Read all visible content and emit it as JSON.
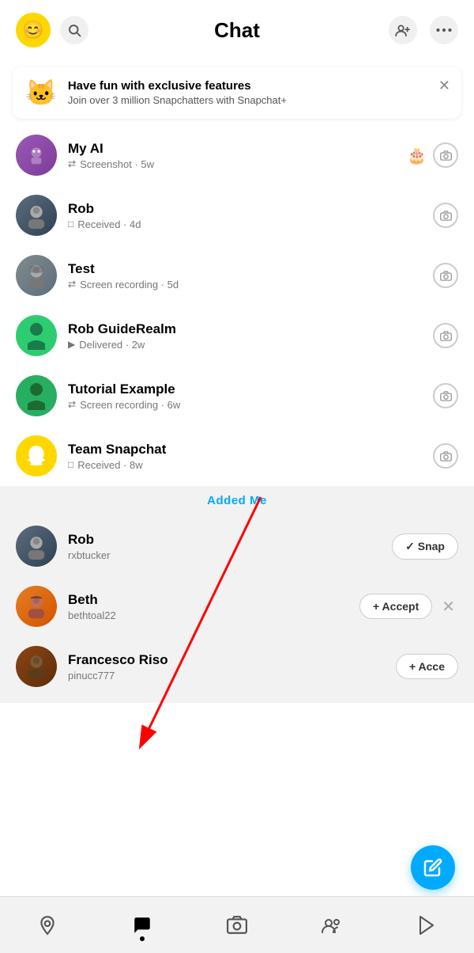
{
  "header": {
    "title": "Chat",
    "avatar_emoji": "😊",
    "add_friend_label": "+👤",
    "more_label": "•••"
  },
  "promo": {
    "emoji": "🐱",
    "title": "Have fun with exclusive features",
    "subtitle": "Join over 3 million Snapchatters with Snapchat+"
  },
  "chats": [
    {
      "name": "My AI",
      "sub_icon": "↔",
      "sub_text": "Screenshot · 5w",
      "avatar_emoji": "🤖",
      "extra_emoji": "🎂",
      "avatar_class": "avatar-myai"
    },
    {
      "name": "Rob",
      "sub_icon": "□",
      "sub_text": "Received · 4d",
      "avatar_class": "avatar-rob",
      "avatar_emoji": "🧑"
    },
    {
      "name": "Test",
      "sub_icon": "↔",
      "sub_text": "Screen recording · 5d",
      "avatar_class": "avatar-test",
      "avatar_emoji": "🧑"
    },
    {
      "name": "Rob GuideRealm",
      "sub_icon": "▶",
      "sub_text": "Delivered · 2w",
      "avatar_class": "avatar-robguide",
      "avatar_emoji": "🧑"
    },
    {
      "name": "Tutorial Example",
      "sub_icon": "↔",
      "sub_text": "Screen recording · 6w",
      "avatar_class": "avatar-tutorial",
      "avatar_emoji": "🧑"
    },
    {
      "name": "Team Snapchat",
      "sub_icon": "□",
      "sub_text": "Received · 8w",
      "avatar_class": "avatar-snapchat",
      "avatar_emoji": "👻"
    }
  ],
  "added_me": {
    "section_title": "Added Me",
    "items": [
      {
        "name": "Rob",
        "username": "rxbtucker",
        "avatar_class": "avatar-rob2",
        "avatar_emoji": "🧑",
        "action": "snap",
        "action_label": "✓ Snap"
      },
      {
        "name": "Beth",
        "username": "bethtoal22",
        "avatar_class": "avatar-beth",
        "avatar_emoji": "👩",
        "action": "accept",
        "action_label": "+ Accept",
        "dismissable": true
      },
      {
        "name": "Francesco Riso",
        "username": "pinucc777",
        "avatar_class": "avatar-francesco",
        "avatar_emoji": "🧑",
        "action": "accept",
        "action_label": "+ Acce",
        "dismissable": false
      }
    ]
  },
  "fab": {
    "icon": "✏",
    "color": "#00AAFF"
  },
  "bottom_nav": {
    "items": [
      {
        "icon": "◎",
        "name": "map",
        "active": false
      },
      {
        "icon": "💬",
        "name": "chat",
        "active": true
      },
      {
        "icon": "⊙",
        "name": "camera",
        "active": false
      },
      {
        "icon": "👥",
        "name": "friends",
        "active": false
      },
      {
        "icon": "▷",
        "name": "stories",
        "active": false
      }
    ]
  }
}
